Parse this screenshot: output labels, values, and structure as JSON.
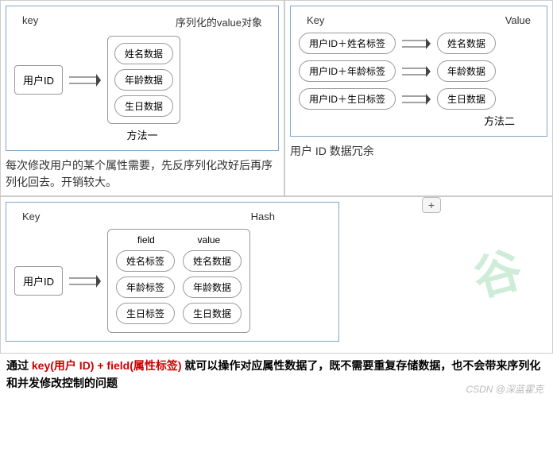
{
  "method1": {
    "keyHeader": "key",
    "valueHeader": "序列化的value对象",
    "keyLabel": "用户ID",
    "values": [
      "姓名数据",
      "年龄数据",
      "生日数据"
    ],
    "methodLabel": "方法一",
    "caption": "每次修改用户的某个属性需要，先反序列化改好后再序列化回去。开销较大。"
  },
  "method2": {
    "keyHeader": "Key",
    "valueHeader": "Value",
    "rows": [
      {
        "key": "用户ID＋姓名标签",
        "value": "姓名数据"
      },
      {
        "key": "用户ID＋年龄标签",
        "value": "年龄数据"
      },
      {
        "key": "用户ID＋生日标签",
        "value": "生日数据"
      }
    ],
    "methodLabel": "方法二",
    "caption": "用户 ID 数据冗余"
  },
  "method3": {
    "keyHeader": "Key",
    "valueHeader": "Hash",
    "keyLabel": "用户ID",
    "fieldHeader": "field",
    "valueColHeader": "value",
    "rows": [
      {
        "field": "姓名标签",
        "value": "姓名数据"
      },
      {
        "field": "年龄标签",
        "value": "年龄数据"
      },
      {
        "field": "生日标签",
        "value": "生日数据"
      }
    ],
    "plusButton": "+"
  },
  "summary": {
    "p1": "通过 ",
    "red": "key(用户 ID) + field(属性标签) ",
    "p2": "就可以操作对应属性数据了，既不需要重复存储数据，也不会带来序列化和并发修改控制的问题"
  },
  "watermark": {
    "csdn": "CSDN @深蓝霍克",
    "green": "谷"
  }
}
